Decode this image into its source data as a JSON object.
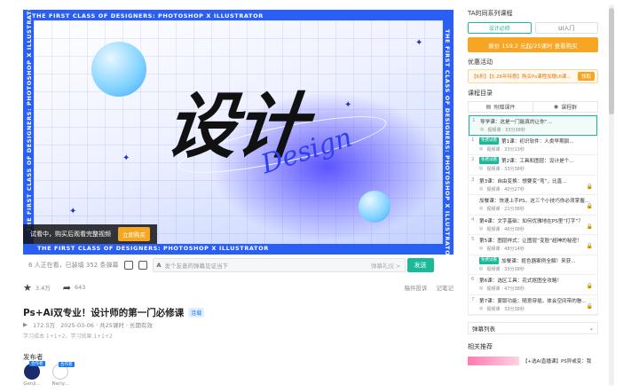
{
  "video": {
    "frame_text": "THE FIRST CLASS OF DESIGNERS: PHOTOSHOP X ILLUSTRATOR",
    "frame_text_short": "SHOP X ILLUSTRATOR",
    "title_big": "设计",
    "title_script": "Design",
    "trial_text": "试看中，购买后观看完整视频",
    "trial_btn": "立即购买"
  },
  "bar": {
    "viewers": "6 人正在看，已装填 352 条弹幕",
    "danmu_icon": "A",
    "danmu_placeholder": "发个友善的弹幕见证当下",
    "etiquette": "弹幕礼仪 >",
    "send": "发送"
  },
  "actions": {
    "likes": "3.4万",
    "shares": "643",
    "report": "稿件投诉",
    "note": "记笔记"
  },
  "course": {
    "title": "Ps+Ai双专业！设计师的第一门必修课",
    "tag": "连载",
    "views": "172.5万",
    "lessons": "2025-03-06 · 共25课时 · 长期有效",
    "meta2": "学习成本 1+1+2，学习效果 1+1+2",
    "publisher_label": "发布者",
    "publishers": [
      {
        "name": "Genji...",
        "badge": "合作者"
      },
      {
        "name": "Nerly...",
        "badge": "合作者"
      }
    ]
  },
  "panel": {
    "same_series": "TA的同系列课程",
    "tabs": [
      "设计必修",
      "UI入门"
    ],
    "buy": "原价 159.2 元起/25课时 查看购买",
    "promo_label": "优惠活动",
    "promo_text": "【6折】【5.26年特惠】购买Ps课程加赠UI课...",
    "promo_btn": "领取",
    "dir_label": "课程目录",
    "dir_tabs": [
      "附赠课件",
      "课程群"
    ],
    "lessons": [
      {
        "n": "1",
        "title": "导学课：这是一门能真的让你“...",
        "sub": "视频课 · 33分38秒",
        "free": false,
        "lock": false,
        "on": true
      },
      {
        "n": "1",
        "title": "第1课：初识软件：人类早期驯...",
        "sub": "视频课 · 33分13秒",
        "free": true,
        "lock": false,
        "on": false
      },
      {
        "n": "2",
        "title": "第2课：工具和图层：设计是个...",
        "sub": "视频课 · 33分38秒",
        "free": true,
        "lock": false,
        "on": false
      },
      {
        "n": "3",
        "title": "第3课：自由变换：想要变“弯”，比直...",
        "sub": "视频课 · 40分27秒",
        "free": false,
        "lock": true,
        "on": false
      },
      {
        "n": "",
        "title": "加餐课：快速上手PS，这三个小技巧你必须掌握...",
        "sub": "视频课 · 21分38秒",
        "free": false,
        "lock": true,
        "on": false
      },
      {
        "n": "4",
        "title": "第4课：文字基础：如何优雅地在PS里“打字”？",
        "sub": "视频课 · 46分38秒",
        "free": false,
        "lock": true,
        "on": false
      },
      {
        "n": "5",
        "title": "第5课：图层样式：让图层“变脸”超神的秘密！",
        "sub": "视频课 · 48分14秒",
        "free": false,
        "lock": true,
        "on": false
      },
      {
        "n": "",
        "title": "加餐课：抠色器案例全解！来获...",
        "sub": "视频课 · 33分38秒",
        "free": true,
        "lock": false,
        "on": false
      },
      {
        "n": "6",
        "title": "第6课：选区工具：花式抠图全攻略！",
        "sub": "视频课 · 47分38秒",
        "free": false,
        "lock": true,
        "on": false
      },
      {
        "n": "7",
        "title": "第7课：蒙版功能：随意穿插，体会空间带的魅...",
        "sub": "视频课 · 33分38秒",
        "free": false,
        "lock": true,
        "on": false
      }
    ],
    "danmu_list": "弹幕列表",
    "rec_label": "相关推荐",
    "rec_item": "【+选AI直播课】PS异或变：我"
  }
}
